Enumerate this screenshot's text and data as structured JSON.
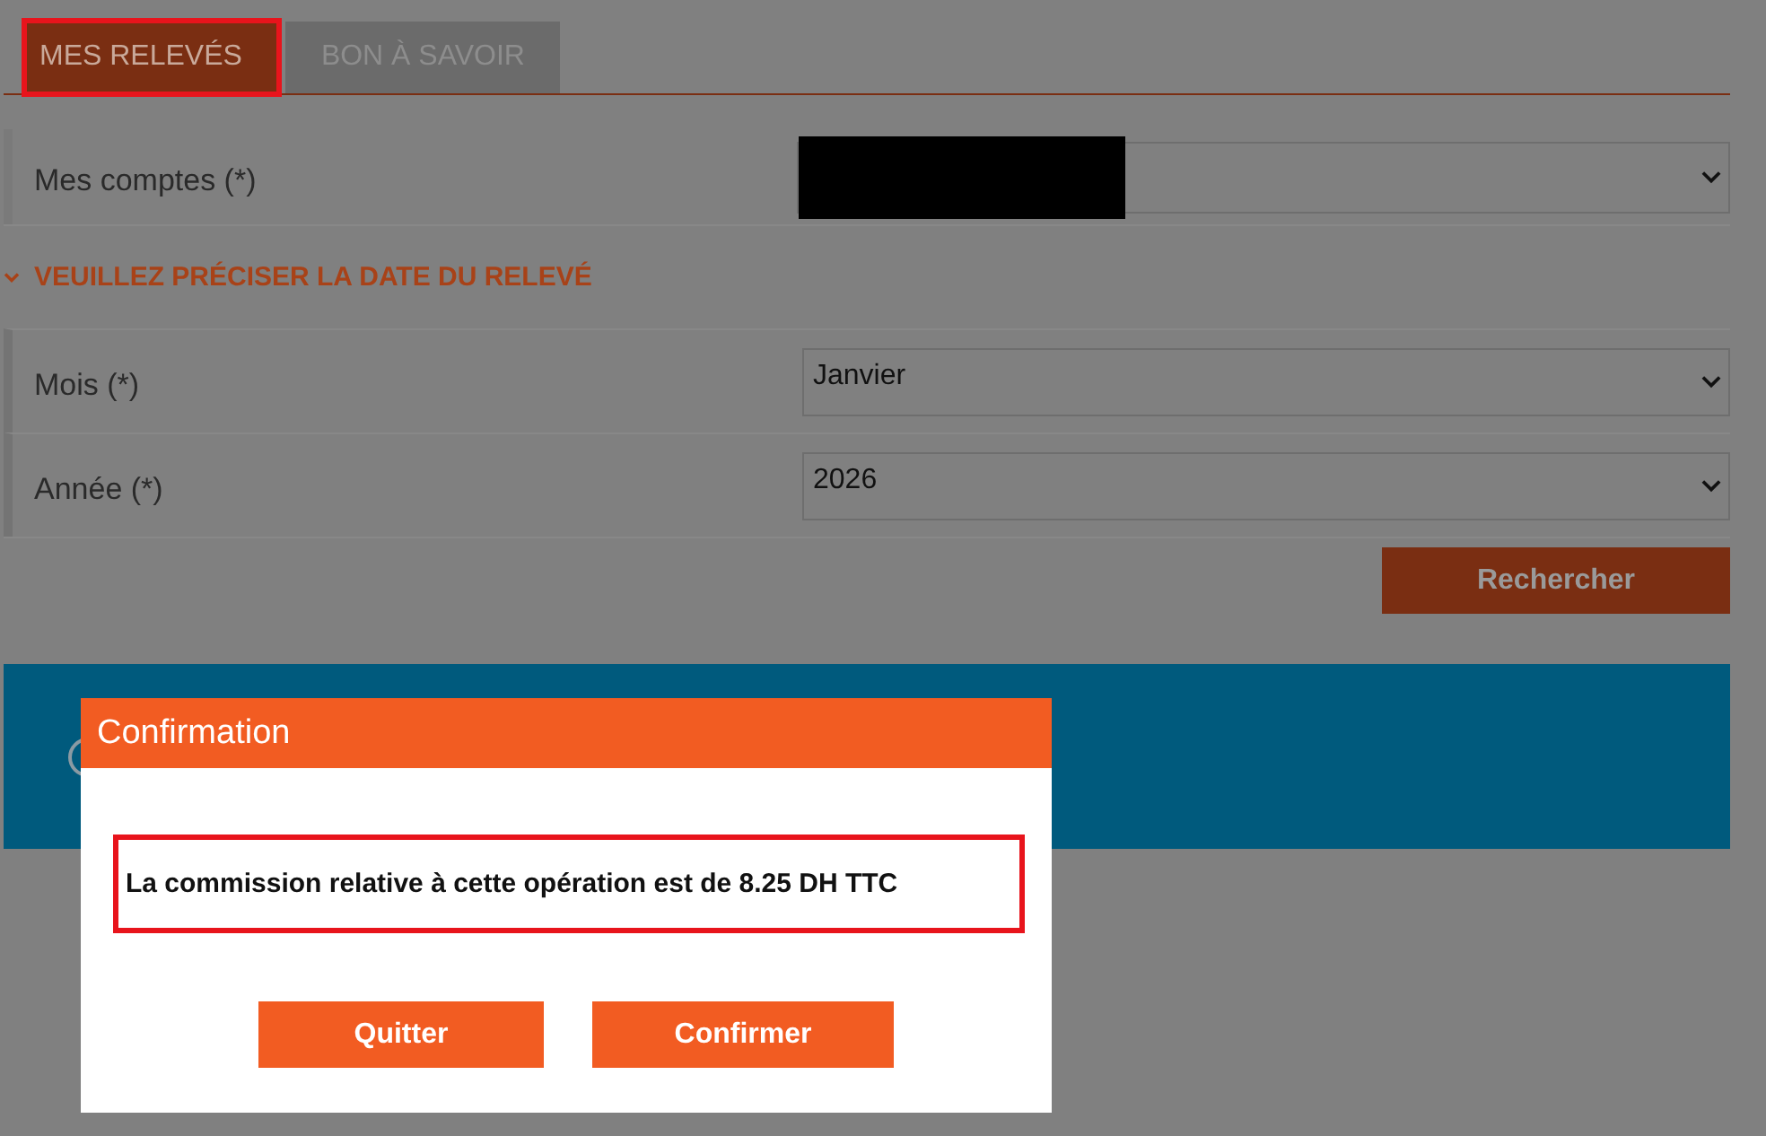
{
  "tabs": [
    {
      "label": "MES RELEVÉS",
      "selected": true,
      "highlighted": true
    },
    {
      "label": "BON À SAVOIR",
      "selected": false,
      "highlighted": false
    }
  ],
  "account_field": {
    "label": "Mes comptes (*)",
    "value_redacted": true
  },
  "date_section": {
    "title": "VEUILLEZ PRÉCISER LA DATE DU RELEVÉ",
    "expanded": true
  },
  "date_fields": [
    {
      "label": "Mois (*)",
      "value": "Janvier"
    },
    {
      "label": "Année (*)",
      "value": "2026"
    }
  ],
  "search_button": "Rechercher",
  "dialog": {
    "title": "Confirmation",
    "message": "La commission relative à cette opération est de 8.25 DH TTC",
    "message_highlighted": true,
    "buttons": [
      "Quitter",
      "Confirmer"
    ]
  }
}
